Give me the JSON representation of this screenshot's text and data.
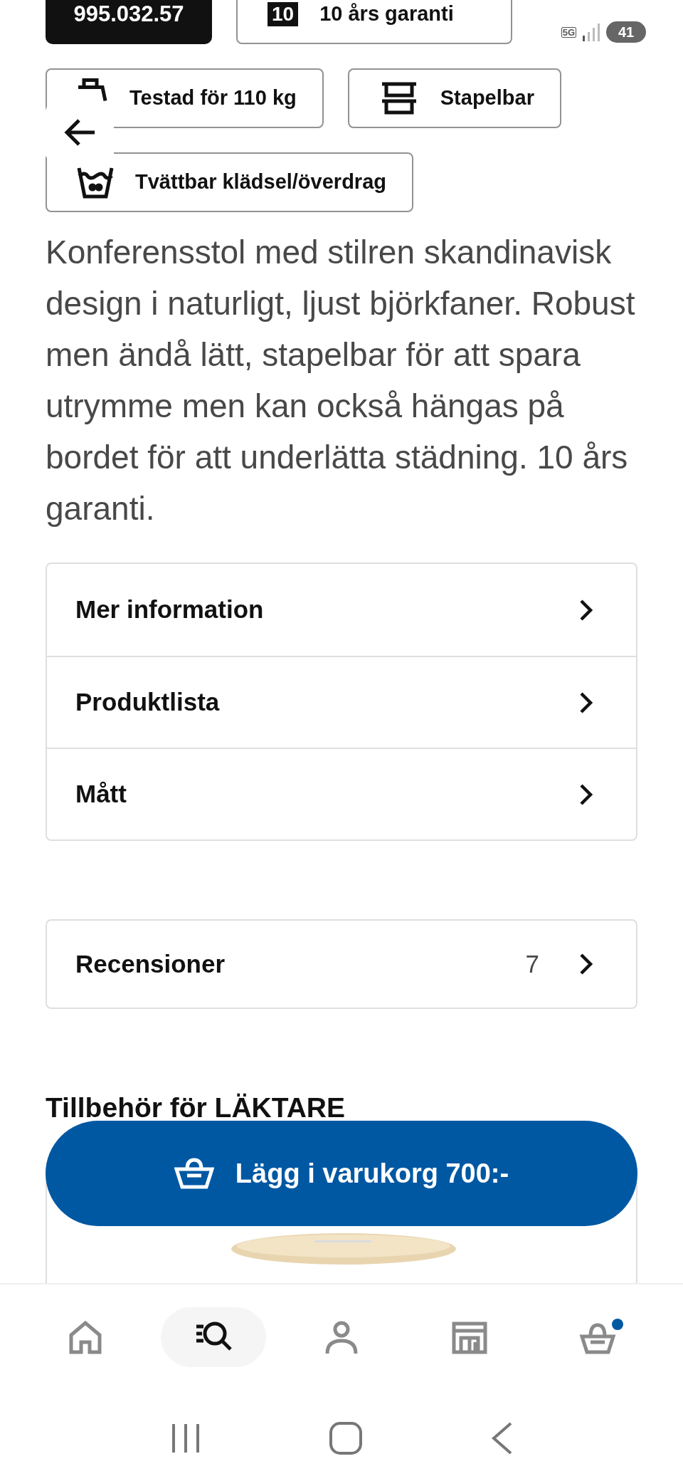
{
  "article_number": "995.032.57",
  "status_bar": {
    "network": "5G",
    "battery": "41"
  },
  "feature_chips": [
    {
      "kind": "warranty",
      "badge": "10",
      "label": "10 års garanti"
    },
    {
      "kind": "weight",
      "label": "Testad för 110 kg"
    },
    {
      "kind": "stackable",
      "label": "Stapelbar"
    },
    {
      "kind": "washable",
      "label": "Tvättbar klädsel/överdrag"
    }
  ],
  "description": "Konferensstol med stilren skandinavisk design i naturligt, ljust björkfaner. Robust men ändå lätt, stapelbar för att spara utrymme men kan också hängas på bordet för att underlätta städning. 10 års garanti.",
  "info_links": [
    {
      "label": "Mer information"
    },
    {
      "label": "Produktlista"
    },
    {
      "label": "Mått"
    }
  ],
  "reviews": {
    "label": "Recensioner",
    "count": "7"
  },
  "accessories_heading": "Tillbehör för LÄKTARE",
  "add_to_cart": {
    "label": "Lägg i varukorg 700:-"
  },
  "bottom_nav": [
    {
      "kind": "home",
      "selected": false,
      "notification": false
    },
    {
      "kind": "search",
      "selected": true,
      "notification": false
    },
    {
      "kind": "profile",
      "selected": false,
      "notification": false
    },
    {
      "kind": "store",
      "selected": false,
      "notification": false
    },
    {
      "kind": "cart",
      "selected": false,
      "notification": true
    }
  ]
}
